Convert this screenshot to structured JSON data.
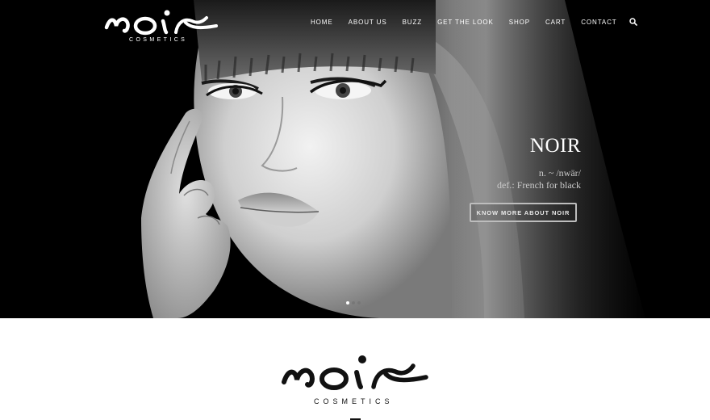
{
  "brand": {
    "wordmark": "noir",
    "subtitle": "COSMETICS"
  },
  "nav": {
    "items": [
      {
        "label": "HOME"
      },
      {
        "label": "ABOUT US"
      },
      {
        "label": "BUZZ"
      },
      {
        "label": "GET THE LOOK"
      },
      {
        "label": "SHOP"
      },
      {
        "label": "CART"
      },
      {
        "label": "CONTACT"
      }
    ],
    "search_icon": "search-icon"
  },
  "hero": {
    "title": "NOIR",
    "line1": "n. ~ /nwär/",
    "line2": "def.: French for black",
    "button_label": "KNOW MORE ABOUT NOIR",
    "slides_total": 3,
    "active_slide": 1
  },
  "section": {
    "logo_wordmark": "noir",
    "logo_subtitle": "COSMETICS"
  },
  "colors": {
    "hero_background": "#000000",
    "page_background": "#ffffff",
    "text_light": "#ffffff",
    "text_dark": "#111111"
  }
}
